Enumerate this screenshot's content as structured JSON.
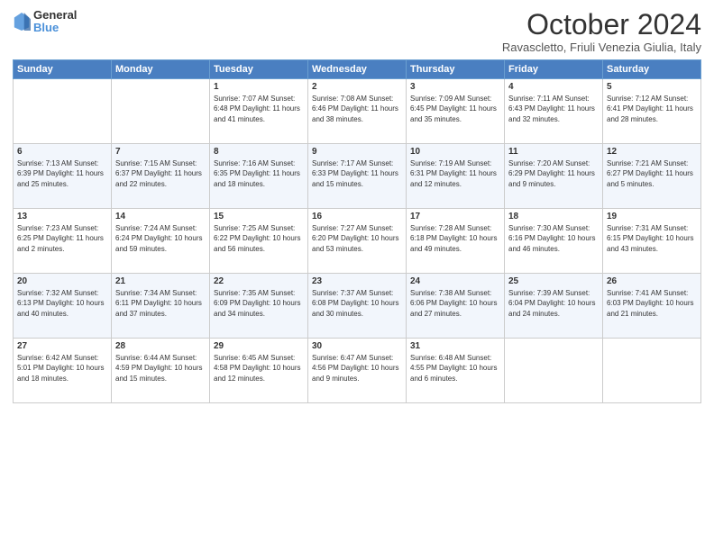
{
  "header": {
    "logo_line1": "General",
    "logo_line2": "Blue",
    "month_title": "October 2024",
    "location": "Ravascletto, Friuli Venezia Giulia, Italy"
  },
  "weekdays": [
    "Sunday",
    "Monday",
    "Tuesday",
    "Wednesday",
    "Thursday",
    "Friday",
    "Saturday"
  ],
  "weeks": [
    [
      {
        "day": "",
        "info": ""
      },
      {
        "day": "",
        "info": ""
      },
      {
        "day": "1",
        "info": "Sunrise: 7:07 AM\nSunset: 6:48 PM\nDaylight: 11 hours and 41 minutes."
      },
      {
        "day": "2",
        "info": "Sunrise: 7:08 AM\nSunset: 6:46 PM\nDaylight: 11 hours and 38 minutes."
      },
      {
        "day": "3",
        "info": "Sunrise: 7:09 AM\nSunset: 6:45 PM\nDaylight: 11 hours and 35 minutes."
      },
      {
        "day": "4",
        "info": "Sunrise: 7:11 AM\nSunset: 6:43 PM\nDaylight: 11 hours and 32 minutes."
      },
      {
        "day": "5",
        "info": "Sunrise: 7:12 AM\nSunset: 6:41 PM\nDaylight: 11 hours and 28 minutes."
      }
    ],
    [
      {
        "day": "6",
        "info": "Sunrise: 7:13 AM\nSunset: 6:39 PM\nDaylight: 11 hours and 25 minutes."
      },
      {
        "day": "7",
        "info": "Sunrise: 7:15 AM\nSunset: 6:37 PM\nDaylight: 11 hours and 22 minutes."
      },
      {
        "day": "8",
        "info": "Sunrise: 7:16 AM\nSunset: 6:35 PM\nDaylight: 11 hours and 18 minutes."
      },
      {
        "day": "9",
        "info": "Sunrise: 7:17 AM\nSunset: 6:33 PM\nDaylight: 11 hours and 15 minutes."
      },
      {
        "day": "10",
        "info": "Sunrise: 7:19 AM\nSunset: 6:31 PM\nDaylight: 11 hours and 12 minutes."
      },
      {
        "day": "11",
        "info": "Sunrise: 7:20 AM\nSunset: 6:29 PM\nDaylight: 11 hours and 9 minutes."
      },
      {
        "day": "12",
        "info": "Sunrise: 7:21 AM\nSunset: 6:27 PM\nDaylight: 11 hours and 5 minutes."
      }
    ],
    [
      {
        "day": "13",
        "info": "Sunrise: 7:23 AM\nSunset: 6:25 PM\nDaylight: 11 hours and 2 minutes."
      },
      {
        "day": "14",
        "info": "Sunrise: 7:24 AM\nSunset: 6:24 PM\nDaylight: 10 hours and 59 minutes."
      },
      {
        "day": "15",
        "info": "Sunrise: 7:25 AM\nSunset: 6:22 PM\nDaylight: 10 hours and 56 minutes."
      },
      {
        "day": "16",
        "info": "Sunrise: 7:27 AM\nSunset: 6:20 PM\nDaylight: 10 hours and 53 minutes."
      },
      {
        "day": "17",
        "info": "Sunrise: 7:28 AM\nSunset: 6:18 PM\nDaylight: 10 hours and 49 minutes."
      },
      {
        "day": "18",
        "info": "Sunrise: 7:30 AM\nSunset: 6:16 PM\nDaylight: 10 hours and 46 minutes."
      },
      {
        "day": "19",
        "info": "Sunrise: 7:31 AM\nSunset: 6:15 PM\nDaylight: 10 hours and 43 minutes."
      }
    ],
    [
      {
        "day": "20",
        "info": "Sunrise: 7:32 AM\nSunset: 6:13 PM\nDaylight: 10 hours and 40 minutes."
      },
      {
        "day": "21",
        "info": "Sunrise: 7:34 AM\nSunset: 6:11 PM\nDaylight: 10 hours and 37 minutes."
      },
      {
        "day": "22",
        "info": "Sunrise: 7:35 AM\nSunset: 6:09 PM\nDaylight: 10 hours and 34 minutes."
      },
      {
        "day": "23",
        "info": "Sunrise: 7:37 AM\nSunset: 6:08 PM\nDaylight: 10 hours and 30 minutes."
      },
      {
        "day": "24",
        "info": "Sunrise: 7:38 AM\nSunset: 6:06 PM\nDaylight: 10 hours and 27 minutes."
      },
      {
        "day": "25",
        "info": "Sunrise: 7:39 AM\nSunset: 6:04 PM\nDaylight: 10 hours and 24 minutes."
      },
      {
        "day": "26",
        "info": "Sunrise: 7:41 AM\nSunset: 6:03 PM\nDaylight: 10 hours and 21 minutes."
      }
    ],
    [
      {
        "day": "27",
        "info": "Sunrise: 6:42 AM\nSunset: 5:01 PM\nDaylight: 10 hours and 18 minutes."
      },
      {
        "day": "28",
        "info": "Sunrise: 6:44 AM\nSunset: 4:59 PM\nDaylight: 10 hours and 15 minutes."
      },
      {
        "day": "29",
        "info": "Sunrise: 6:45 AM\nSunset: 4:58 PM\nDaylight: 10 hours and 12 minutes."
      },
      {
        "day": "30",
        "info": "Sunrise: 6:47 AM\nSunset: 4:56 PM\nDaylight: 10 hours and 9 minutes."
      },
      {
        "day": "31",
        "info": "Sunrise: 6:48 AM\nSunset: 4:55 PM\nDaylight: 10 hours and 6 minutes."
      },
      {
        "day": "",
        "info": ""
      },
      {
        "day": "",
        "info": ""
      }
    ]
  ]
}
